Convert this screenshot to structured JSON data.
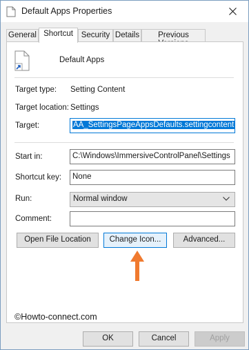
{
  "window": {
    "title": "Default Apps Properties"
  },
  "tabs": [
    {
      "label": "General"
    },
    {
      "label": "Shortcut"
    },
    {
      "label": "Security"
    },
    {
      "label": "Details"
    },
    {
      "label": "Previous Versions"
    }
  ],
  "shortcut": {
    "name": "Default Apps",
    "target_type_label": "Target type:",
    "target_type": "Setting Content",
    "target_location_label": "Target location:",
    "target_location": "Settings",
    "target_label": "Target:",
    "target_value": "AA_SettingsPageAppsDefaults.settingcontent-ms",
    "start_in_label": "Start in:",
    "start_in_value": "C:\\Windows\\ImmersiveControlPanel\\Settings",
    "shortcut_key_label": "Shortcut key:",
    "shortcut_key_value": "None",
    "run_label": "Run:",
    "run_value": "Normal window",
    "comment_label": "Comment:",
    "comment_value": ""
  },
  "buttons": {
    "open_file_location": "Open File Location",
    "change_icon": "Change Icon...",
    "advanced": "Advanced...",
    "ok": "OK",
    "cancel": "Cancel",
    "apply": "Apply"
  },
  "watermark": "©Howto-connect.com",
  "colors": {
    "accent": "#0078d7",
    "arrow": "#f07a2f"
  }
}
